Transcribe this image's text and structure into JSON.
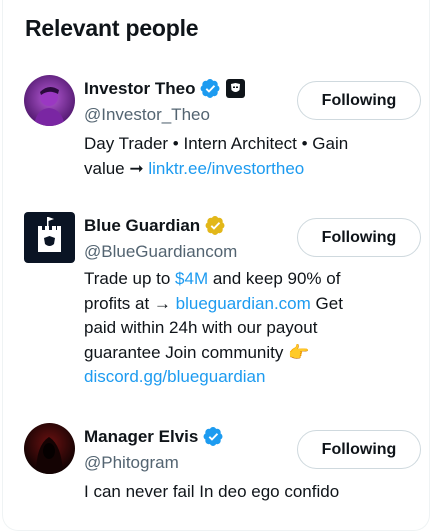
{
  "section": {
    "title": "Relevant people"
  },
  "people": [
    {
      "name": "Investor Theo",
      "handle": "@Investor_Theo",
      "verified": "blue",
      "affiliate_badge": "shield-mask-icon",
      "button": "Following",
      "bio_line1": "Day Trader • Intern Architect • Gain",
      "bio_line2_pre": "value ➞ ",
      "bio_link": "linktr.ee/investortheo"
    },
    {
      "name": "Blue Guardian",
      "handle": "@BlueGuardiancom",
      "verified": "gold",
      "button": "Following",
      "bio_l1_pre": "Trade up to ",
      "bio_l1_link": "$4M",
      "bio_l1_post": " and keep 90% of",
      "bio_l2_pre": "profits at → ",
      "bio_l2_link": "blueguardian.com",
      "bio_l2_post": " Get",
      "bio_l3": "paid within 24h with our payout",
      "bio_l4": "guarantee Join community 👉",
      "bio_l5_link": "discord.gg/blueguardian"
    },
    {
      "name": "Manager Elvis",
      "handle": "@Phitogram",
      "verified": "blue",
      "button": "Following",
      "bio": "I can never fail In deo ego confido"
    }
  ],
  "colors": {
    "link": "#1d9bf0",
    "verified_blue": "#1d9bf0",
    "verified_gold": "#e2b719",
    "muted": "#536471"
  }
}
